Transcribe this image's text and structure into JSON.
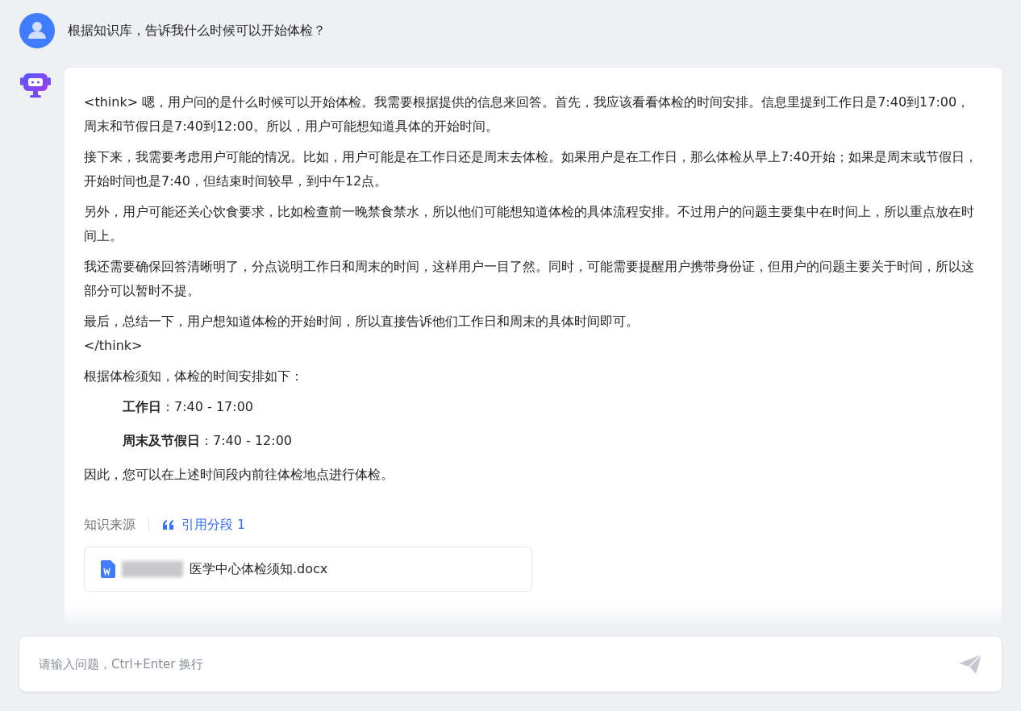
{
  "user_message": {
    "text": "根据知识库，告诉我什么时候可以开始体检？"
  },
  "answer": {
    "think_paragraphs": [
      "<think> 嗯，用户问的是什么时候可以开始体检。我需要根据提供的信息来回答。首先，我应该看看体检的时间安排。信息里提到工作日是7:40到17:00，周末和节假日是7:40到12:00。所以，用户可能想知道具体的开始时间。",
      "接下来，我需要考虑用户可能的情况。比如，用户可能是在工作日还是周末去体检。如果用户是在工作日，那么体检从早上7:40开始；如果是周末或节假日，开始时间也是7:40，但结束时间较早，到中午12点。",
      "另外，用户可能还关心饮食要求，比如检查前一晚禁食禁水，所以他们可能想知道体检的具体流程安排。不过用户的问题主要集中在时间上，所以重点放在时间上。",
      "我还需要确保回答清晰明了，分点说明工作日和周末的时间，这样用户一目了然。同时，可能需要提醒用户携带身份证，但用户的问题主要关于时间，所以这部分可以暂时不提。",
      "最后，总结一下，用户想知道体检的开始时间，所以直接告诉他们工作日和周末的具体时间即可。"
    ],
    "think_close": "</think>",
    "intro": "根据体检须知，体检的时间安排如下：",
    "schedule": [
      {
        "text": "**工作日**：7:40 - 17:00"
      },
      {
        "text": "**周末及节假日**：7:40 - 12:00"
      }
    ],
    "conclusion": "因此，您可以在上述时间段内前往体检地点进行体检。",
    "sources": {
      "label": "知识来源",
      "citation": "引用分段 1",
      "file": {
        "name": "医学中心体检须知.docx",
        "redacted": true
      }
    }
  },
  "input": {
    "placeholder": "请输入问题，Ctrl+Enter 换行"
  }
}
